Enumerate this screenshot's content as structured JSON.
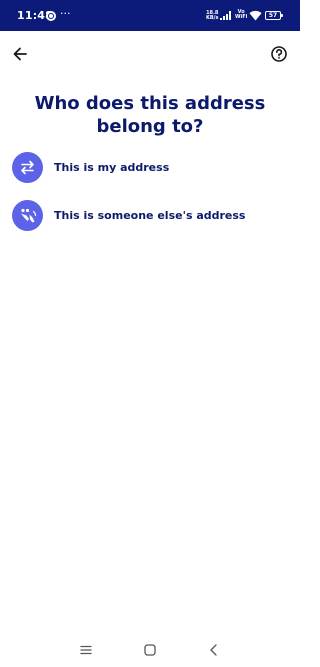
{
  "status_bar": {
    "time": "11:48",
    "more": "···",
    "net_speed_value": "18.8",
    "net_speed_unit": "KB/s",
    "vo_label": "Vo",
    "wifi_label": "WiFi",
    "battery": "57",
    "background": "#0c1a7a"
  },
  "header": {
    "back_icon": "arrow-left-icon",
    "help_icon": "help-circle-icon"
  },
  "page": {
    "title": "Who does this address belong to?"
  },
  "options": [
    {
      "label": "This is my address",
      "icon": "swap-arrows-icon"
    },
    {
      "label": "This is someone else's address",
      "icon": "people-wave-icon"
    }
  ],
  "nav_bar": {
    "menu_icon": "menu-icon",
    "home_icon": "home-square-icon",
    "back_icon": "back-chevron-icon"
  },
  "colors": {
    "title_text": "#0c1a6b",
    "accent": "#5c63e8",
    "status_bar": "#0c1a7a"
  }
}
